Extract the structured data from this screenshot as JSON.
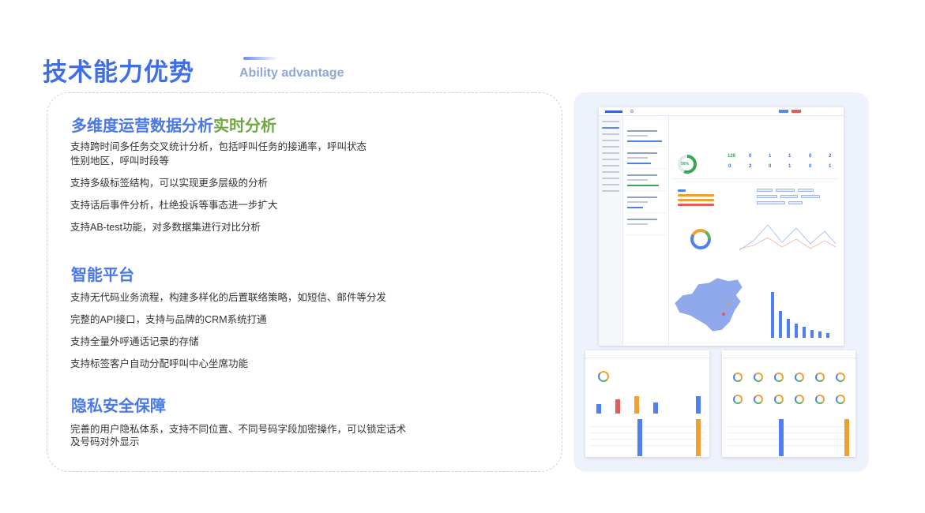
{
  "header": {
    "title": "技术能力优势",
    "subtitle": "Ability advantage"
  },
  "sections": [
    {
      "title_main": "多维度运营数据分析",
      "title_accent": "实时分析",
      "lines": [
        "支持跨时间多任务交叉统计分析，包括呼叫任务的接通率，呼叫状态",
        "性别地区，呼叫时段等",
        "支持多级标签结构，可以实现更多层级的分析",
        "支持话后事件分析，杜绝投诉等事态进一步扩大",
        "支持AB-test功能，对多数据集进行对比分析"
      ]
    },
    {
      "title_main": "智能平台",
      "lines": [
        "支持无代码业务流程，构建多样化的后置联络策略，如短信、邮件等分发",
        "完整的API接口，支持与品牌的CRM系统打通",
        "支持全量外呼通话记录的存储",
        "支持标签客户自动分配呼叫中心坐席功能"
      ]
    },
    {
      "title_main": "隐私安全保障",
      "lines": [
        "完善的用户隐私体系，支持不同位置、不同号码字段加密操作，可以锁定话术",
        "及号码对外显示"
      ]
    }
  ],
  "dashboard": {
    "kpis": [
      "128",
      "0",
      "1",
      "1",
      "0",
      "2",
      "0",
      "2",
      "0",
      "1",
      "0",
      "1"
    ],
    "donut_percent": "56%",
    "donut_fraction": 0.56
  },
  "colors": {
    "title": "#3f6fe6",
    "subtitle": "#8fa6d9",
    "accent_green": "#6fa840",
    "panel_bg": "#eef2fc",
    "chart_blue": "#4f7ff0"
  }
}
